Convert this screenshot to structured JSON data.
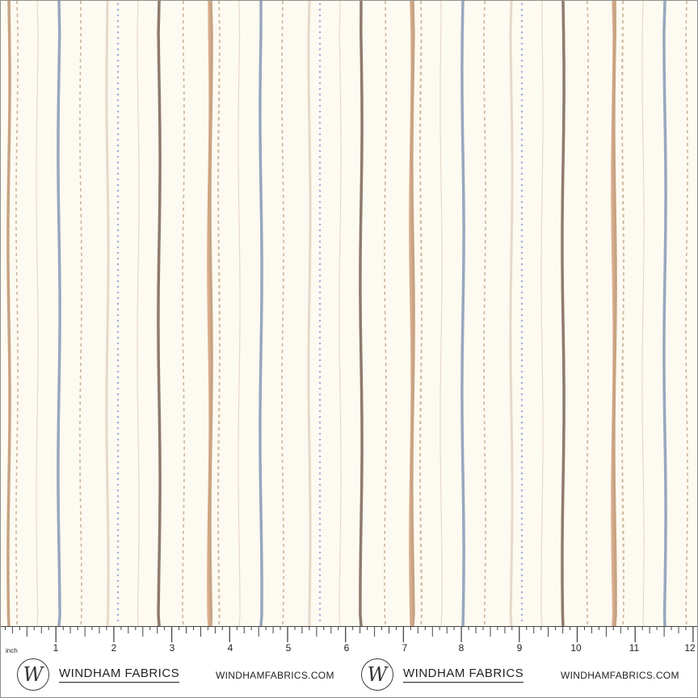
{
  "fabric": {
    "background": "#fdfaf1",
    "stripe_colors": {
      "tan": "#c7a383",
      "blue": "#97a8be",
      "brown": "#8e7b6d",
      "peach": "#d9ad8d",
      "dot_blue": "#a6b1de",
      "dash_tan": "#cdb598",
      "pale": "#e6d9c9"
    }
  },
  "ruler": {
    "unit_label": "inch",
    "numbers": [
      "1",
      "2",
      "3",
      "4",
      "5",
      "6",
      "7",
      "8",
      "9",
      "10",
      "11",
      "12"
    ]
  },
  "branding": {
    "logo_letter": "W",
    "name": "WINDHAM FABRICS",
    "website": "WINDHAMFABRICS.COM"
  }
}
